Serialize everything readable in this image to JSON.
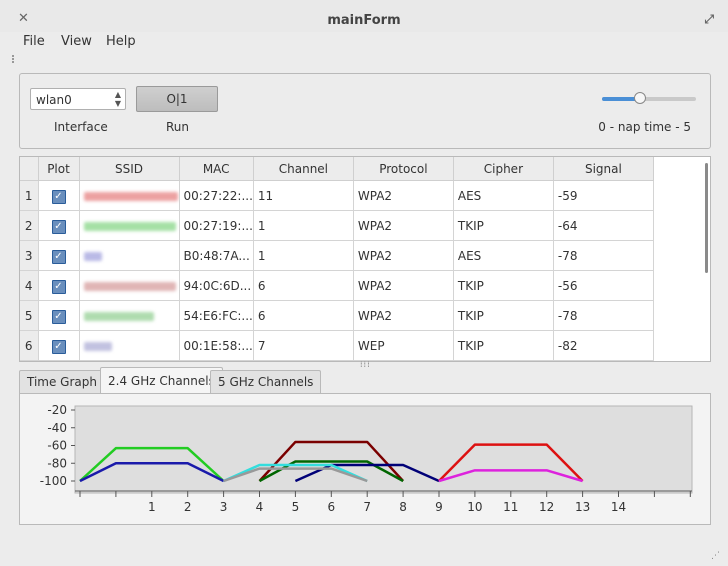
{
  "window": {
    "title": "mainForm"
  },
  "menu": {
    "items": [
      "File",
      "View",
      "Help"
    ]
  },
  "controls": {
    "interface_value": "wlan0",
    "interface_label": "Interface",
    "run_button": "O|1",
    "run_label": "Run",
    "nap_text": "0 - nap time - 5",
    "nap_slider_value": 0.4
  },
  "table": {
    "headers": [
      "",
      "Plot",
      "SSID",
      "MAC",
      "Channel",
      "Protocol",
      "Cipher",
      "Signal"
    ],
    "rows": [
      {
        "num": "1",
        "ssid_color": "#e88a8a",
        "ssid_width": 94,
        "mac": "00:27:22:...",
        "channel": "11",
        "protocol": "WPA2",
        "cipher": "AES",
        "signal": "-59"
      },
      {
        "num": "2",
        "ssid_color": "#8fd98f",
        "ssid_width": 92,
        "mac": "00:27:19:...",
        "channel": "1",
        "protocol": "WPA2",
        "cipher": "TKIP",
        "signal": "-64"
      },
      {
        "num": "3",
        "ssid_color": "#a9a9e0",
        "ssid_width": 18,
        "mac": "B0:48:7A...",
        "channel": "1",
        "protocol": "WPA2",
        "cipher": "AES",
        "signal": "-78"
      },
      {
        "num": "4",
        "ssid_color": "#d9a3a3",
        "ssid_width": 92,
        "mac": "94:0C:6D...",
        "channel": "6",
        "protocol": "WPA2",
        "cipher": "TKIP",
        "signal": "-56"
      },
      {
        "num": "5",
        "ssid_color": "#9bd39b",
        "ssid_width": 70,
        "mac": "54:E6:FC:...",
        "channel": "6",
        "protocol": "WPA2",
        "cipher": "TKIP",
        "signal": "-78"
      },
      {
        "num": "6",
        "ssid_color": "#b3b3d9",
        "ssid_width": 28,
        "mac": "00:1E:58:...",
        "channel": "7",
        "protocol": "WEP",
        "cipher": "TKIP",
        "signal": "-82"
      }
    ]
  },
  "tabs": [
    {
      "label": "Time Graph",
      "active": false
    },
    {
      "label": "2.4 GHz Channels",
      "active": true
    },
    {
      "label": "5 GHz Channels",
      "active": false
    }
  ],
  "chart_data": {
    "type": "line",
    "title": "",
    "xlabel": "",
    "ylabel": "",
    "xlim": [
      -1,
      17
    ],
    "ylim": [
      -100,
      -20
    ],
    "yticks": [
      -20,
      -40,
      -60,
      -80,
      -100
    ],
    "xticks": [
      1,
      2,
      3,
      4,
      5,
      6,
      7,
      8,
      9,
      10,
      11,
      12,
      13,
      14
    ],
    "grid": false,
    "series": [
      {
        "color": "#22cc22",
        "points": [
          [
            -1,
            -100
          ],
          [
            0,
            -63
          ],
          [
            2,
            -63
          ],
          [
            3,
            -100
          ]
        ]
      },
      {
        "color": "#1a1aaa",
        "points": [
          [
            -1,
            -100
          ],
          [
            0,
            -80
          ],
          [
            2,
            -80
          ],
          [
            3,
            -100
          ]
        ]
      },
      {
        "color": "#7a0000",
        "points": [
          [
            4,
            -100
          ],
          [
            5,
            -56
          ],
          [
            7,
            -56
          ],
          [
            8,
            -100
          ]
        ]
      },
      {
        "color": "#006600",
        "points": [
          [
            4,
            -100
          ],
          [
            5,
            -78
          ],
          [
            7,
            -78
          ],
          [
            8,
            -100
          ]
        ]
      },
      {
        "color": "#000077",
        "points": [
          [
            5,
            -100
          ],
          [
            6,
            -82
          ],
          [
            8,
            -82
          ],
          [
            9,
            -100
          ]
        ]
      },
      {
        "color": "#33dddd",
        "points": [
          [
            3,
            -100
          ],
          [
            4,
            -82
          ],
          [
            6,
            -82
          ],
          [
            7,
            -100
          ]
        ]
      },
      {
        "color": "#999999",
        "points": [
          [
            3,
            -100
          ],
          [
            4,
            -86
          ],
          [
            6,
            -86
          ],
          [
            7,
            -100
          ]
        ]
      },
      {
        "color": "#dd1111",
        "points": [
          [
            9,
            -100
          ],
          [
            10,
            -59
          ],
          [
            12,
            -59
          ],
          [
            13,
            -100
          ]
        ]
      },
      {
        "color": "#dd22dd",
        "points": [
          [
            9,
            -100
          ],
          [
            10,
            -88
          ],
          [
            12,
            -88
          ],
          [
            13,
            -100
          ]
        ]
      }
    ]
  }
}
